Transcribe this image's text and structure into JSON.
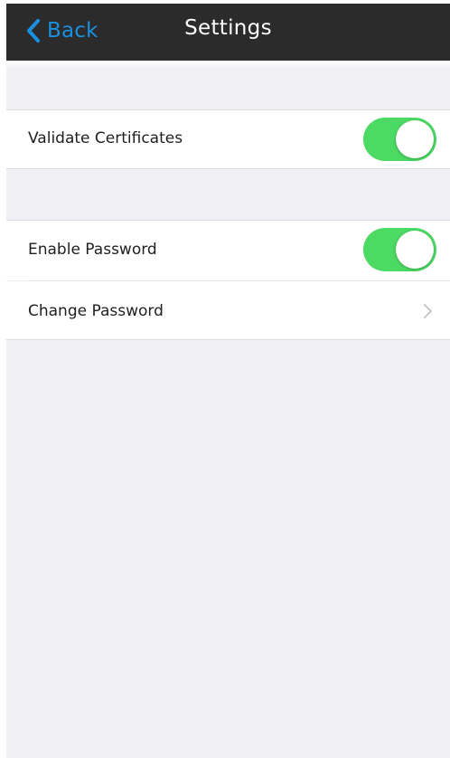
{
  "navbar": {
    "back_label": "Back",
    "back_icon": "chevron-left-icon",
    "title": "Settings"
  },
  "settings": {
    "validate_certificates": {
      "label": "Validate Certificates",
      "enabled": true
    },
    "enable_password": {
      "label": "Enable Password",
      "enabled": true
    },
    "change_password": {
      "label": "Change Password",
      "icon": "chevron-right-icon"
    }
  },
  "colors": {
    "navbar_background": "#2b2b2b",
    "accent": "#1a90e0",
    "toggle_on": "#4cd964",
    "page_background": "#efeff4"
  }
}
